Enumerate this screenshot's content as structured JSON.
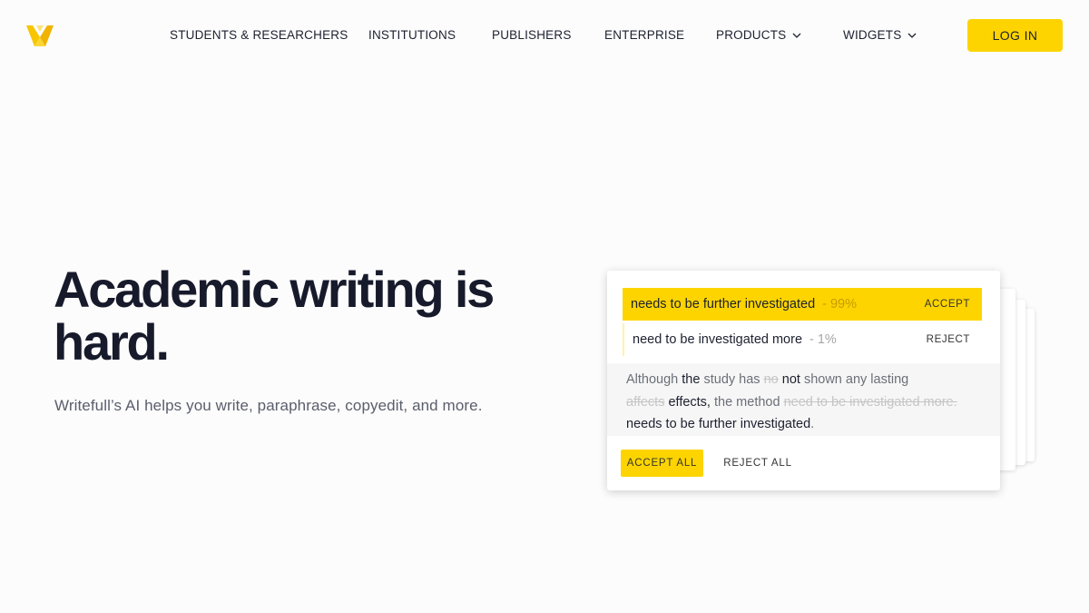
{
  "brand": {
    "accent": "#fdd400",
    "logo_icon": "writefull-logo-icon"
  },
  "nav": {
    "items": [
      {
        "label": "STUDENTS & RESEARCHERS"
      },
      {
        "label": "INSTITUTIONS"
      },
      {
        "label": "PUBLISHERS"
      },
      {
        "label": "ENTERPRISE"
      },
      {
        "label": "PRODUCTS",
        "icon": "chevron-down-icon"
      },
      {
        "label": "WIDGETS",
        "icon": "chevron-down-icon"
      }
    ],
    "login_label": "LOG IN"
  },
  "hero": {
    "title": "Academic writing is hard.",
    "subtitle": "Writefull’s AI helps you write, paraphrase, copyedit, and more."
  },
  "demo": {
    "suggestions": [
      {
        "text": "needs to be further investigated",
        "pct": "- 99%",
        "action": "ACCEPT"
      },
      {
        "text": "need to be investigated more",
        "pct": "- 1%",
        "action": "REJECT"
      }
    ],
    "preview": {
      "t1": "Although ",
      "t2": "the",
      "t3": " study has ",
      "t4": "no",
      "t5": " ",
      "t6": "not",
      "t7": " shown any lasting",
      "t8": "affects",
      "t9": " ",
      "t10": "effects,",
      "t11": " the method ",
      "t12": "need to be investigated more.",
      "t13": "needs to be further investigated",
      "t14": "."
    },
    "accept_all_label": "ACCEPT ALL",
    "reject_all_label": "REJECT ALL"
  }
}
